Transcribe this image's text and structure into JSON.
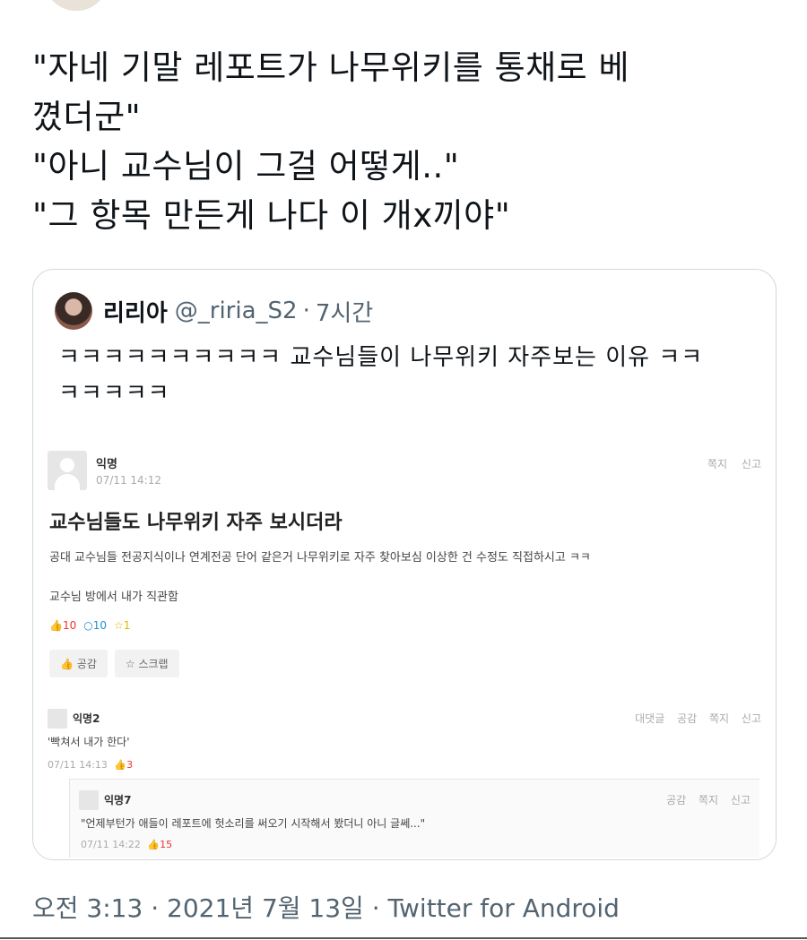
{
  "tweet": {
    "lines": [
      "\"자네 기말 레포트가 나무위키를 통채로 베",
      "꼈더군\"",
      "\"아니 교수님이 그걸 어떻게..\"",
      "\"그 항목 만든게 나다 이 개x끼야\""
    ]
  },
  "quote": {
    "name": "리리아",
    "handle": "@_riria_S2",
    "separator": "·",
    "time": "7시간",
    "text_line1": "ㅋㅋㅋㅋㅋㅋㅋㅋㅋㅋ 교수님들이 나무위키 자주보는 이유 ㅋㅋ",
    "text_line2": "ㅋㅋㅋㅋㅋ"
  },
  "post": {
    "author": "익명",
    "date": "07/11 14:12",
    "actions": [
      "쪽지",
      "신고"
    ],
    "title": "교수님들도 나무위키 자주 보시더라",
    "body1": "공대 교수님들 전공지식이나 연계전공 단어 같은거 나무위키로 자주 찾아보심 이상한 건 수정도 직접하시고 ㅋㅋ",
    "body2": "교수님 방에서 내가 직관함",
    "stats": {
      "likes": "10",
      "comments": "10",
      "scraps": "1"
    },
    "buttons": {
      "empathy": "공감",
      "scrap": "스크랩"
    }
  },
  "comments": [
    {
      "author": "익명2",
      "actions": [
        "대댓글",
        "공감",
        "쪽지",
        "신고"
      ],
      "text": "'빡쳐서 내가 한다'",
      "date": "07/11 14:13",
      "likes": "3"
    }
  ],
  "reply": {
    "author": "익명7",
    "actions": [
      "공감",
      "쪽지",
      "신고"
    ],
    "text": "\"언제부턴가 애들이 레포트에 헛소리를 써오기 시작해서 봤더니 아니 글쎄...\"",
    "date": "07/11 14:22",
    "likes": "15"
  },
  "footer": {
    "time": "오전 3:13",
    "date": "2021년 7월 13일",
    "source": "Twitter for Android",
    "separator": "·"
  },
  "icons": {
    "like": "thumbs-up-icon",
    "comment": "speech-bubble-icon",
    "scrap": "star-icon"
  },
  "colors": {
    "text_primary": "#0f1419",
    "text_secondary": "#536471",
    "card_border": "#cfd9de",
    "like_red": "#ee3333",
    "comment_blue": "#2a8bd4",
    "scrap_yellow": "#e9b200"
  }
}
